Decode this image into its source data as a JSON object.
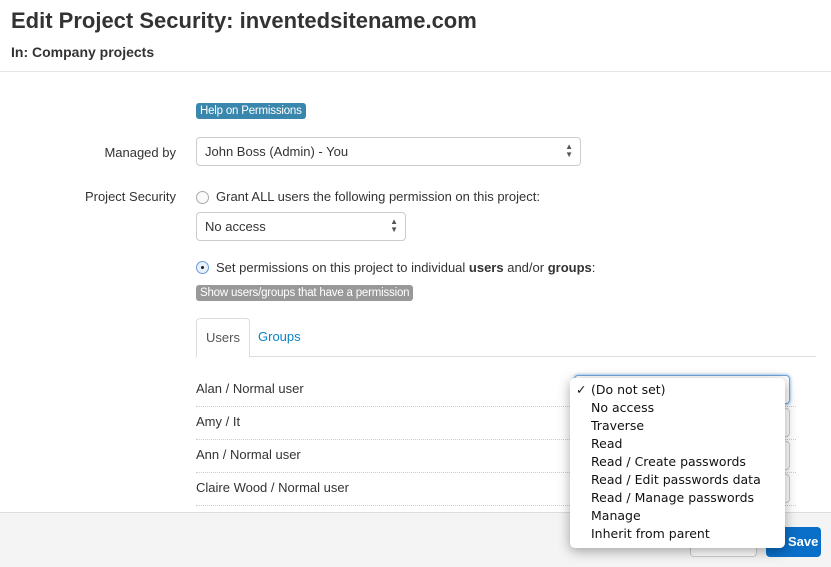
{
  "header": {
    "title": "Edit Project Security: inventedsitename.com",
    "subtitle": "In: Company projects"
  },
  "form": {
    "help_label": "Help on Permissions",
    "managed_by_label": "Managed by",
    "managed_by_value": "John Boss (Admin) - You",
    "project_security_label": "Project Security",
    "grant_all_text": "Grant ALL users the following permission on this project:",
    "grant_all_checked": false,
    "grant_all_value": "No access",
    "individual_text_1": "Set permissions on this project to individual ",
    "individual_bold_1": "users",
    "individual_text_2": " and/or ",
    "individual_bold_2": "groups",
    "individual_text_3": ":",
    "individual_checked": true,
    "show_button": "Show users/groups that have a permission"
  },
  "tabs": [
    {
      "label": "Users",
      "active": true
    },
    {
      "label": "Groups",
      "active": false
    }
  ],
  "users": [
    {
      "name": "Alan / Normal user",
      "permission": ""
    },
    {
      "name": "Amy / It",
      "permission": ""
    },
    {
      "name": "Ann / Normal user",
      "permission": ""
    },
    {
      "name": "Claire Wood / Normal user",
      "permission": ""
    }
  ],
  "dropdown": {
    "selected": "(Do not set)",
    "check": "✓",
    "options": [
      "(Do not set)",
      "No access",
      "Traverse",
      "Read",
      "Read / Create passwords",
      "Read / Edit passwords data",
      "Read / Manage passwords",
      "Manage",
      "Inherit from parent"
    ]
  },
  "footer": {
    "cancel_label": "",
    "save_label": "Save"
  },
  "colors": {
    "help": "#3a87ad",
    "link": "#0b84c6",
    "save": "#0a6fc8"
  }
}
